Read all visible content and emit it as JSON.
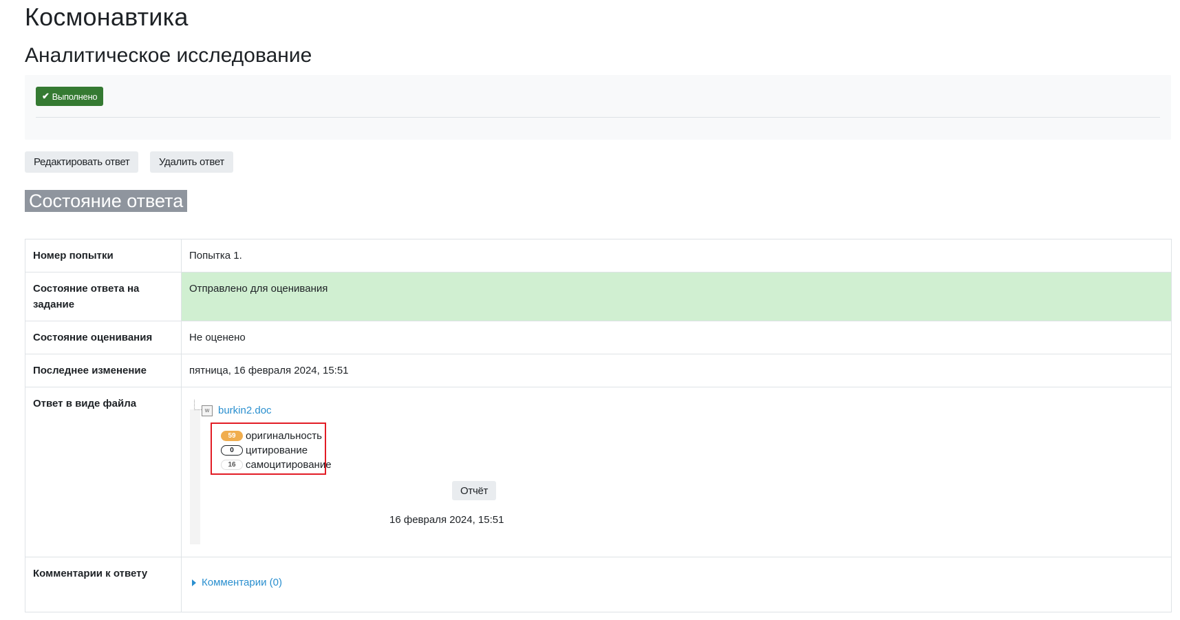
{
  "header": {
    "course_title": "Космонавтика",
    "activity_title": "Аналитическое исследование"
  },
  "completion": {
    "badge_label": "Выполнено",
    "badge_icon": "check-icon"
  },
  "actions": {
    "edit_label": "Редактировать ответ",
    "delete_label": "Удалить ответ"
  },
  "submission": {
    "heading": "Состояние ответа",
    "rows": [
      {
        "label": "Номер попытки",
        "value": "Попытка 1."
      },
      {
        "label": "Состояние ответа на задание",
        "value": "Отправлено для оценивания"
      },
      {
        "label": "Состояние оценивания",
        "value": "Не оценено"
      },
      {
        "label": "Последнее изменение",
        "value": "пятница, 16 февраля 2024, 15:51"
      },
      {
        "label": "Ответ в виде файла",
        "value": ""
      },
      {
        "label": "Комментарии к ответу",
        "value": ""
      }
    ],
    "file": {
      "name": "burkin2.doc",
      "icon": "doc-file-icon",
      "originality_value": "59",
      "originality_label": "оригинальность",
      "citation_value": "0",
      "citation_label": "цитирование",
      "self_citation_value": "16",
      "self_citation_label": "самоцитирование",
      "report_label": "Отчёт",
      "date": "16 февраля 2024, 15:51"
    },
    "comments_link": "Комментарии (0)"
  },
  "colors": {
    "badge_green": "#357a32",
    "submitted_bg": "#d0efd1",
    "link_blue": "#2a8fcf",
    "originality_pill": "#f0ad4e",
    "highlight_box": "#e21b24"
  }
}
